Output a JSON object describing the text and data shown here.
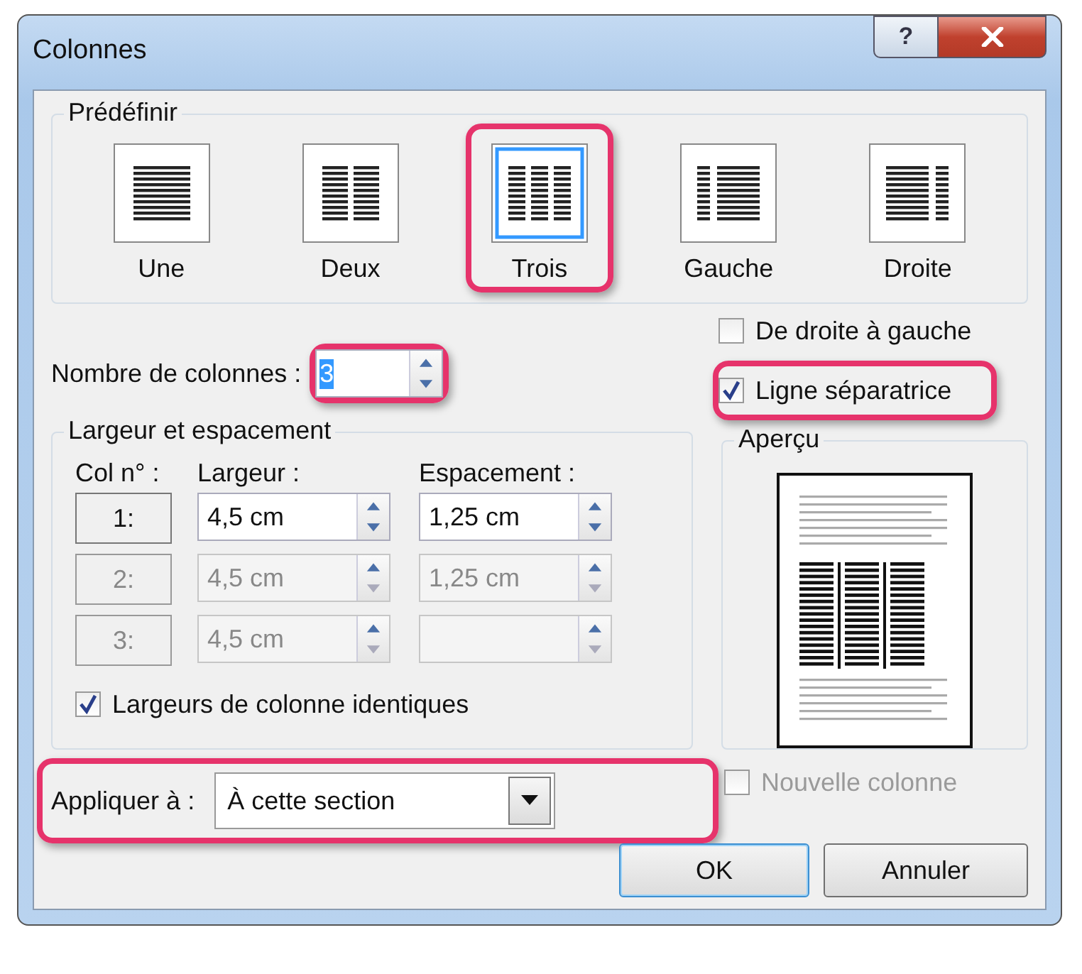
{
  "window": {
    "title": "Colonnes",
    "help_button": "?"
  },
  "presets_group": {
    "title": "Prédéfinir"
  },
  "presets": [
    {
      "label": "Une",
      "kind": "one",
      "selected": false,
      "highlighted": false
    },
    {
      "label": "Deux",
      "kind": "two",
      "selected": false,
      "highlighted": false
    },
    {
      "label": "Trois",
      "kind": "three",
      "selected": true,
      "highlighted": true
    },
    {
      "label": "Gauche",
      "kind": "left",
      "selected": false,
      "highlighted": false
    },
    {
      "label": "Droite",
      "kind": "right",
      "selected": false,
      "highlighted": false
    }
  ],
  "columns_count": {
    "label": "Nombre de colonnes :",
    "value": "3",
    "value_selected": true,
    "highlighted": true
  },
  "right_to_left": {
    "label": "De droite à gauche",
    "checked": false,
    "highlighted": false
  },
  "line_between": {
    "label": "Ligne séparatrice",
    "checked": true,
    "highlighted": true
  },
  "width_spacing": {
    "title": "Largeur et espacement",
    "headers": [
      "Col n° :",
      "Largeur :",
      "Espacement :"
    ],
    "rows": [
      {
        "number": "1:",
        "width": "4,5 cm",
        "spacing": "1,25 cm",
        "disabled": false
      },
      {
        "number": "2:",
        "width": "4,5 cm",
        "spacing": "1,25 cm",
        "disabled": true
      },
      {
        "number": "3:",
        "width": "4,5 cm",
        "disabled": true
      }
    ]
  },
  "equal_width": {
    "label": "Largeurs de colonne identiques",
    "checked": true
  },
  "preview": {
    "title": "Aperçu"
  },
  "apply_to": {
    "label": "Appliquer à :",
    "value": "À cette section",
    "highlighted": true
  },
  "new_column": {
    "label": "Nouvelle colonne",
    "checked": false,
    "disabled": true
  },
  "buttons": [
    {
      "label": "OK",
      "default": true
    },
    {
      "label": "Annuler",
      "default": false
    }
  ]
}
